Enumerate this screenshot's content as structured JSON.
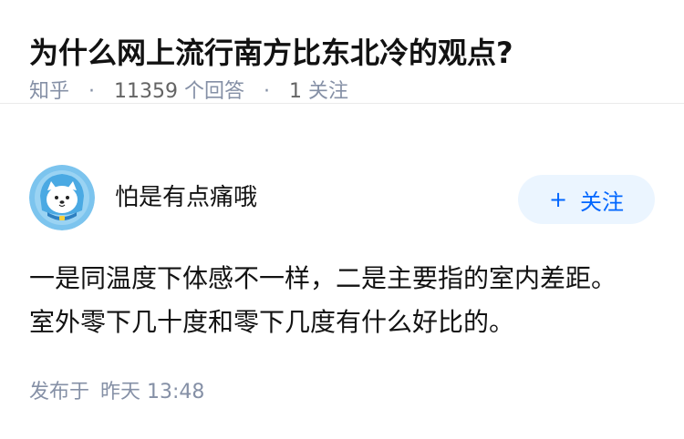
{
  "question": {
    "title": "为什么网上流行南方比东北冷的观点?",
    "source": "知乎",
    "separator": "·",
    "answer_count": "11359",
    "answer_count_label": "个回答",
    "follow_count": "1",
    "follow_count_label": "关注"
  },
  "author": {
    "name": "怕是有点痛哦",
    "avatar_icon": "shiba-dog-avatar-icon",
    "follow_button": {
      "icon": "plus-icon",
      "plus_symbol": "+",
      "label": "关注"
    }
  },
  "answer": {
    "text": "一是同温度下体感不一样，二是主要指的室内差距。室外零下几十度和零下几度有什么好比的。"
  },
  "footer": {
    "published_label": "发布于",
    "published_time": "昨天 13:48"
  },
  "colors": {
    "primary_text": "#121212",
    "meta_text": "#8590a6",
    "accent_blue": "#0066ff",
    "follow_button_bg": "#ebf5ff",
    "divider": "#ebebeb"
  }
}
